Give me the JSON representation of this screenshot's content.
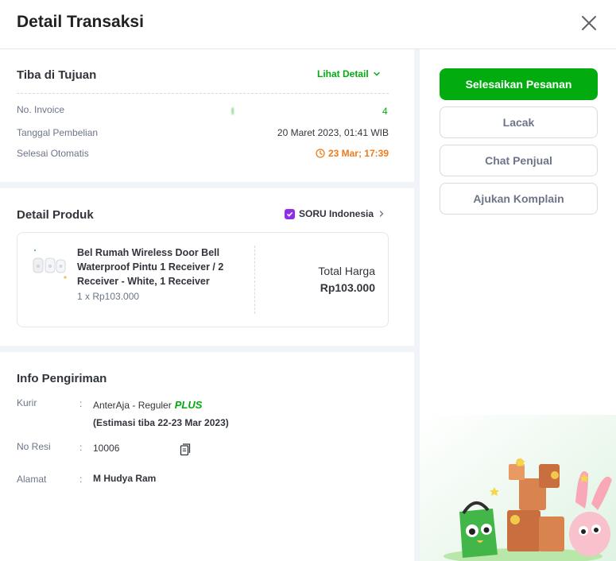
{
  "header": {
    "title": "Detail Transaksi"
  },
  "status": {
    "title": "Tiba di Tujuan",
    "lihat_detail": "Lihat Detail",
    "rows": [
      {
        "label": "No. Invoice",
        "value_left": "I",
        "value_right": "4"
      },
      {
        "label": "Tanggal Pembelian",
        "value": "20 Maret 2023, 01:41 WIB"
      },
      {
        "label": "Selesai Otomatis",
        "value": "23 Mar; 17:39"
      }
    ]
  },
  "product": {
    "title": "Detail Produk",
    "seller": "SORU Indonesia",
    "name": "Bel Rumah Wireless Door Bell Waterproof Pintu 1 Receiver / 2 Receiver - White, 1 Receiver",
    "qty_price": "1 x Rp103.000",
    "total_label": "Total Harga",
    "total_value": "Rp103.000"
  },
  "shipping": {
    "title": "Info Pengiriman",
    "courier_label": "Kurir",
    "courier_value": "AnterAja - Reguler",
    "courier_plus": "PLUS",
    "estimate": "(Estimasi tiba 22-23 Mar 2023)",
    "resi_label": "No Resi",
    "resi_value": "10006",
    "address_label": "Alamat",
    "address_name": "M Hudya Ram",
    "colon": ":"
  },
  "actions": {
    "primary": "Selesaikan Pesanan",
    "track": "Lacak",
    "chat": "Chat Penjual",
    "complain": "Ajukan Komplain"
  },
  "colors": {
    "accent": "#03ac0e",
    "timer": "#ef7b1a",
    "badge": "#8f2ee8"
  }
}
